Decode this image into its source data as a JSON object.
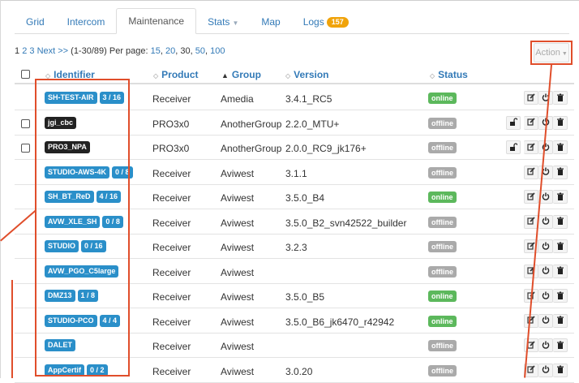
{
  "tabs": [
    {
      "label": "Grid"
    },
    {
      "label": "Intercom"
    },
    {
      "label": "Maintenance"
    },
    {
      "label": "Stats"
    },
    {
      "label": "Map"
    },
    {
      "label": "Logs",
      "badge": "157"
    }
  ],
  "pager": {
    "pages": [
      "1",
      "2",
      "3"
    ],
    "next": "Next >>",
    "range": "(1-30/89)",
    "per_page_label": "Per page:",
    "per_page_options": [
      "15",
      "20",
      "30",
      "50",
      "100"
    ]
  },
  "action_button": {
    "label": "Action"
  },
  "columns": {
    "identifier": "Identifier",
    "product": "Product",
    "group": "Group",
    "version": "Version",
    "status": "Status"
  },
  "rows": [
    {
      "id": "SH-TEST-AIR",
      "count": "3 / 16",
      "dark": false,
      "checkbox": false,
      "product": "Receiver",
      "group": "Amedia",
      "version": "3.4.1_RC5",
      "status": "online",
      "lock": false
    },
    {
      "id": "jgi_cbc",
      "count": "",
      "dark": true,
      "checkbox": true,
      "product": "PRO3x0",
      "group": "AnotherGroup",
      "version": "2.2.0_MTU+",
      "status": "offline",
      "lock": true
    },
    {
      "id": "PRO3_NPA",
      "count": "",
      "dark": true,
      "checkbox": true,
      "product": "PRO3x0",
      "group": "AnotherGroup",
      "version": "2.0.0_RC9_jk176+",
      "status": "offline",
      "lock": true
    },
    {
      "id": "STUDIO-AWS-4K",
      "count": "0 / 8",
      "dark": false,
      "checkbox": false,
      "product": "Receiver",
      "group": "Aviwest",
      "version": "3.1.1",
      "status": "offline",
      "lock": false
    },
    {
      "id": "SH_BT_ReD",
      "count": "4 / 16",
      "dark": false,
      "checkbox": false,
      "product": "Receiver",
      "group": "Aviwest",
      "version": "3.5.0_B4",
      "status": "online",
      "lock": false
    },
    {
      "id": "AVW_XLE_SH",
      "count": "0 / 8",
      "dark": false,
      "checkbox": false,
      "product": "Receiver",
      "group": "Aviwest",
      "version": "3.5.0_B2_svn42522_builder",
      "status": "offline",
      "lock": false
    },
    {
      "id": "STUDIO",
      "count": "0 / 16",
      "dark": false,
      "checkbox": false,
      "product": "Receiver",
      "group": "Aviwest",
      "version": "3.2.3",
      "status": "offline",
      "lock": false
    },
    {
      "id": "AVW_PGO_C5large",
      "count": "",
      "dark": false,
      "checkbox": false,
      "product": "Receiver",
      "group": "Aviwest",
      "version": "",
      "status": "offline",
      "lock": false
    },
    {
      "id": "DMZ13",
      "count": "1 / 8",
      "dark": false,
      "checkbox": false,
      "product": "Receiver",
      "group": "Aviwest",
      "version": "3.5.0_B5",
      "status": "online",
      "lock": false
    },
    {
      "id": "STUDIO-PCO",
      "count": "4 / 4",
      "dark": false,
      "checkbox": false,
      "product": "Receiver",
      "group": "Aviwest",
      "version": "3.5.0_B6_jk6470_r42942",
      "status": "online",
      "lock": false
    },
    {
      "id": "DALET",
      "count": "",
      "dark": false,
      "checkbox": false,
      "product": "Receiver",
      "group": "Aviwest",
      "version": "",
      "status": "offline",
      "lock": false
    },
    {
      "id": "AppCertif",
      "count": "0 / 2",
      "dark": false,
      "checkbox": false,
      "product": "Receiver",
      "group": "Aviwest",
      "version": "3.0.20",
      "status": "offline",
      "lock": false
    }
  ],
  "icons": {
    "edit": "edit-icon",
    "power": "power-icon",
    "delete": "trash-icon",
    "lock": "unlock-icon"
  },
  "colors": {
    "link": "#337ab7",
    "online": "#5cb85c",
    "offline": "#aaaaaa",
    "badge_blue": "#2a8fc9",
    "logs_badge": "#f0a30a",
    "annotation": "#e04e2b"
  }
}
